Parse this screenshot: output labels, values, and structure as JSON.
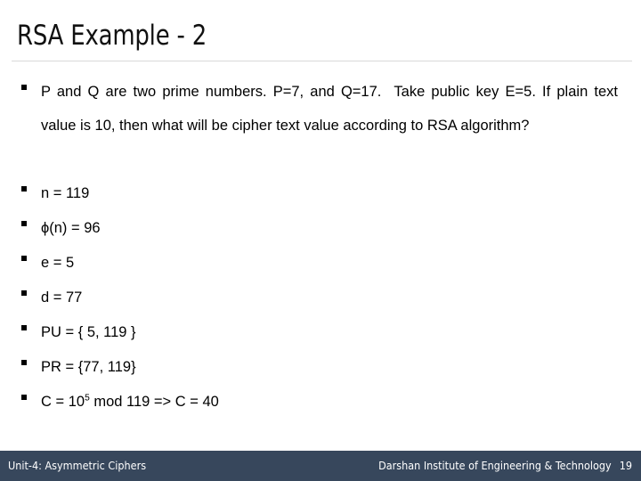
{
  "slide": {
    "title": "RSA Example - 2",
    "bullets": [
      {
        "kind": "paragraph",
        "text": "P and Q are two prime numbers. P=7, and Q=17.  Take public key E=5. If plain text value is 10, then what will be cipher text value according to RSA algorithm?"
      },
      {
        "kind": "line",
        "text": "n = 119"
      },
      {
        "kind": "line",
        "text": "ϕ(n) = 96"
      },
      {
        "kind": "line",
        "text": "e = 5"
      },
      {
        "kind": "line",
        "text": "d = 77"
      },
      {
        "kind": "line",
        "text": "PU = { 5, 119 }"
      },
      {
        "kind": "line",
        "text": "PR = {77, 119}"
      },
      {
        "kind": "line_sup",
        "pre": "C = 10",
        "sup": "5",
        "post": " mod 119 => C = 40"
      }
    ],
    "footer": {
      "left": "Unit-4: Asymmetric Ciphers",
      "right": "Darshan Institute of Engineering & Technology",
      "page_number": "19"
    },
    "colors": {
      "footer_background": "#37475c",
      "footer_text": "#ffffff",
      "title_text": "#111111",
      "body_text": "#000000",
      "rule": "#d9d9d9",
      "slide_background": "#ffffff"
    }
  }
}
